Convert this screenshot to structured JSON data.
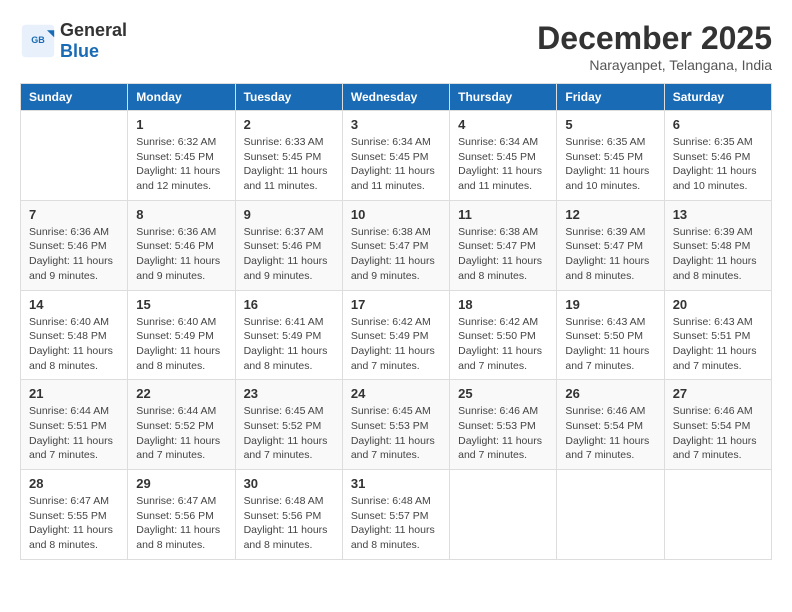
{
  "header": {
    "logo_general": "General",
    "logo_blue": "Blue",
    "month_title": "December 2025",
    "location": "Narayanpet, Telangana, India"
  },
  "days_of_week": [
    "Sunday",
    "Monday",
    "Tuesday",
    "Wednesday",
    "Thursday",
    "Friday",
    "Saturday"
  ],
  "weeks": [
    [
      {
        "day": "",
        "info": ""
      },
      {
        "day": "1",
        "info": "Sunrise: 6:32 AM\nSunset: 5:45 PM\nDaylight: 11 hours and 12 minutes."
      },
      {
        "day": "2",
        "info": "Sunrise: 6:33 AM\nSunset: 5:45 PM\nDaylight: 11 hours and 11 minutes."
      },
      {
        "day": "3",
        "info": "Sunrise: 6:34 AM\nSunset: 5:45 PM\nDaylight: 11 hours and 11 minutes."
      },
      {
        "day": "4",
        "info": "Sunrise: 6:34 AM\nSunset: 5:45 PM\nDaylight: 11 hours and 11 minutes."
      },
      {
        "day": "5",
        "info": "Sunrise: 6:35 AM\nSunset: 5:45 PM\nDaylight: 11 hours and 10 minutes."
      },
      {
        "day": "6",
        "info": "Sunrise: 6:35 AM\nSunset: 5:46 PM\nDaylight: 11 hours and 10 minutes."
      }
    ],
    [
      {
        "day": "7",
        "info": "Sunrise: 6:36 AM\nSunset: 5:46 PM\nDaylight: 11 hours and 9 minutes."
      },
      {
        "day": "8",
        "info": "Sunrise: 6:36 AM\nSunset: 5:46 PM\nDaylight: 11 hours and 9 minutes."
      },
      {
        "day": "9",
        "info": "Sunrise: 6:37 AM\nSunset: 5:46 PM\nDaylight: 11 hours and 9 minutes."
      },
      {
        "day": "10",
        "info": "Sunrise: 6:38 AM\nSunset: 5:47 PM\nDaylight: 11 hours and 9 minutes."
      },
      {
        "day": "11",
        "info": "Sunrise: 6:38 AM\nSunset: 5:47 PM\nDaylight: 11 hours and 8 minutes."
      },
      {
        "day": "12",
        "info": "Sunrise: 6:39 AM\nSunset: 5:47 PM\nDaylight: 11 hours and 8 minutes."
      },
      {
        "day": "13",
        "info": "Sunrise: 6:39 AM\nSunset: 5:48 PM\nDaylight: 11 hours and 8 minutes."
      }
    ],
    [
      {
        "day": "14",
        "info": "Sunrise: 6:40 AM\nSunset: 5:48 PM\nDaylight: 11 hours and 8 minutes."
      },
      {
        "day": "15",
        "info": "Sunrise: 6:40 AM\nSunset: 5:49 PM\nDaylight: 11 hours and 8 minutes."
      },
      {
        "day": "16",
        "info": "Sunrise: 6:41 AM\nSunset: 5:49 PM\nDaylight: 11 hours and 8 minutes."
      },
      {
        "day": "17",
        "info": "Sunrise: 6:42 AM\nSunset: 5:49 PM\nDaylight: 11 hours and 7 minutes."
      },
      {
        "day": "18",
        "info": "Sunrise: 6:42 AM\nSunset: 5:50 PM\nDaylight: 11 hours and 7 minutes."
      },
      {
        "day": "19",
        "info": "Sunrise: 6:43 AM\nSunset: 5:50 PM\nDaylight: 11 hours and 7 minutes."
      },
      {
        "day": "20",
        "info": "Sunrise: 6:43 AM\nSunset: 5:51 PM\nDaylight: 11 hours and 7 minutes."
      }
    ],
    [
      {
        "day": "21",
        "info": "Sunrise: 6:44 AM\nSunset: 5:51 PM\nDaylight: 11 hours and 7 minutes."
      },
      {
        "day": "22",
        "info": "Sunrise: 6:44 AM\nSunset: 5:52 PM\nDaylight: 11 hours and 7 minutes."
      },
      {
        "day": "23",
        "info": "Sunrise: 6:45 AM\nSunset: 5:52 PM\nDaylight: 11 hours and 7 minutes."
      },
      {
        "day": "24",
        "info": "Sunrise: 6:45 AM\nSunset: 5:53 PM\nDaylight: 11 hours and 7 minutes."
      },
      {
        "day": "25",
        "info": "Sunrise: 6:46 AM\nSunset: 5:53 PM\nDaylight: 11 hours and 7 minutes."
      },
      {
        "day": "26",
        "info": "Sunrise: 6:46 AM\nSunset: 5:54 PM\nDaylight: 11 hours and 7 minutes."
      },
      {
        "day": "27",
        "info": "Sunrise: 6:46 AM\nSunset: 5:54 PM\nDaylight: 11 hours and 7 minutes."
      }
    ],
    [
      {
        "day": "28",
        "info": "Sunrise: 6:47 AM\nSunset: 5:55 PM\nDaylight: 11 hours and 8 minutes."
      },
      {
        "day": "29",
        "info": "Sunrise: 6:47 AM\nSunset: 5:56 PM\nDaylight: 11 hours and 8 minutes."
      },
      {
        "day": "30",
        "info": "Sunrise: 6:48 AM\nSunset: 5:56 PM\nDaylight: 11 hours and 8 minutes."
      },
      {
        "day": "31",
        "info": "Sunrise: 6:48 AM\nSunset: 5:57 PM\nDaylight: 11 hours and 8 minutes."
      },
      {
        "day": "",
        "info": ""
      },
      {
        "day": "",
        "info": ""
      },
      {
        "day": "",
        "info": ""
      }
    ]
  ]
}
